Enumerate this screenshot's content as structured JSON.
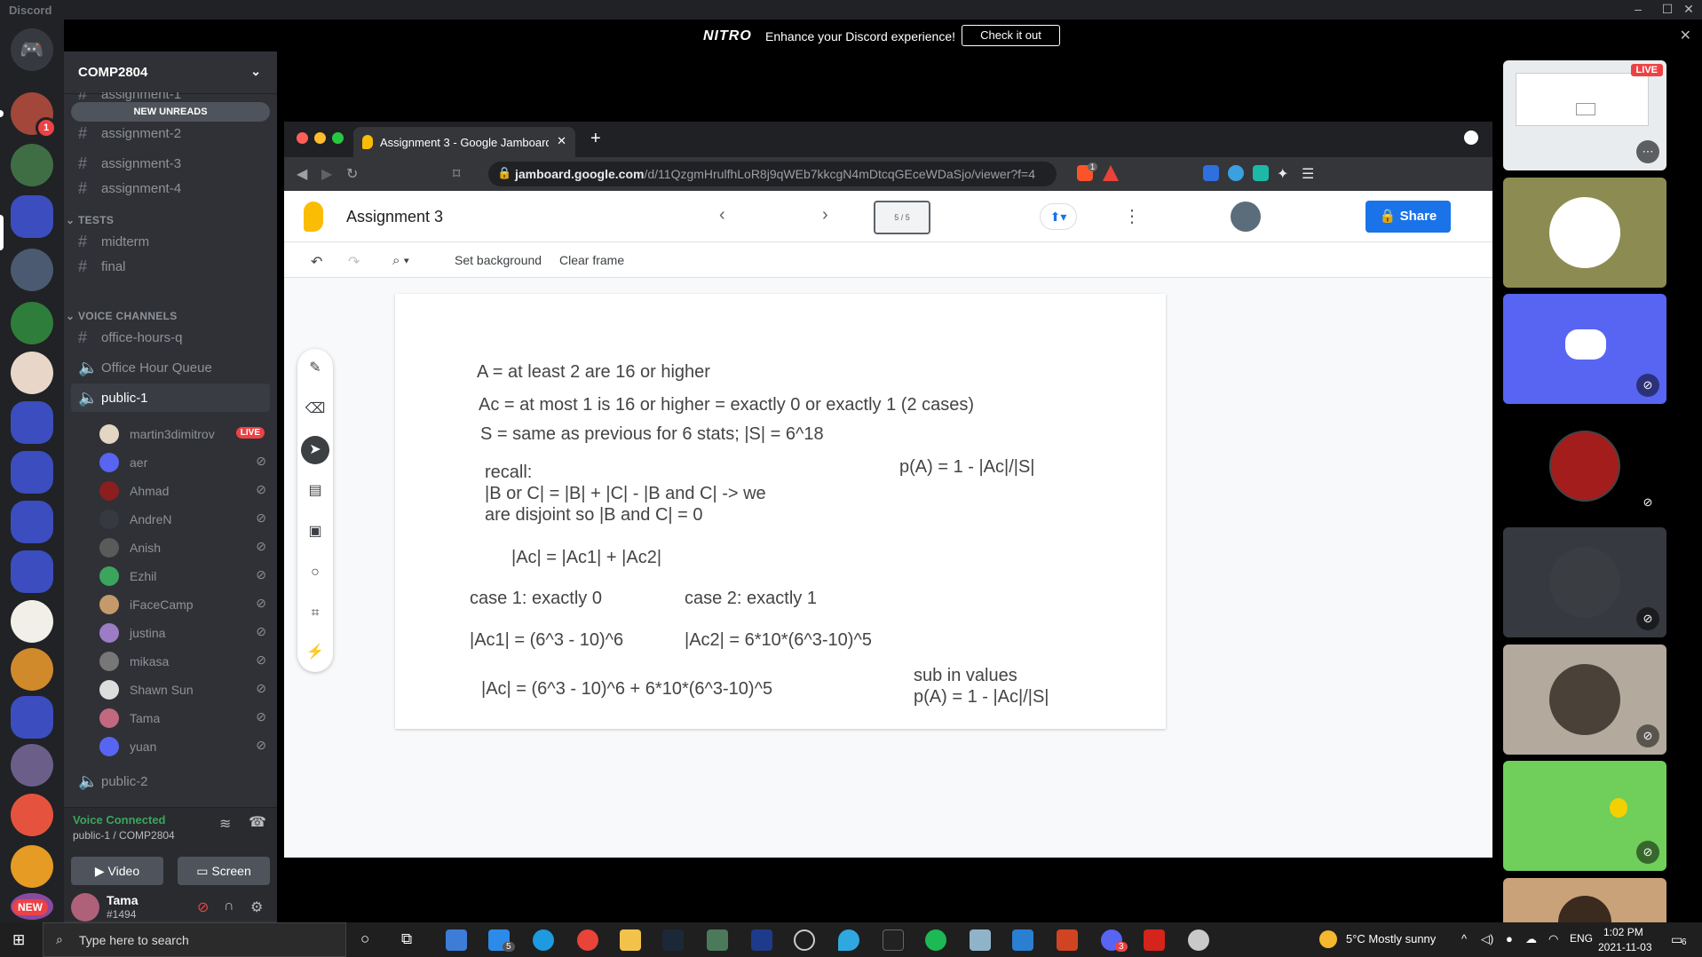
{
  "window": {
    "app_name": "Discord"
  },
  "nitro": {
    "logo": "NITRO",
    "message": "Enhance your Discord experience!",
    "cta": "Check it out"
  },
  "server": {
    "name": "COMP2804",
    "new_unreads": "NEW UNREADS"
  },
  "server_badges": {
    "notification_count": "1",
    "new_label": "NEW"
  },
  "channels": {
    "partial_top": "assignment-1",
    "text_top": [
      "assignment-2",
      "assignment-3",
      "assignment-4"
    ],
    "tests_category": "TESTS",
    "tests": [
      "midterm",
      "final"
    ],
    "voice_category": "VOICE CHANNELS",
    "voice_text": "office-hours-q",
    "voice": [
      "Office Hour Queue",
      "public-1"
    ],
    "voice_bottom": "public-2"
  },
  "voice_users": [
    {
      "name": "martin3dimitrov",
      "live": "LIVE",
      "color": "#e3d6c2"
    },
    {
      "name": "aer",
      "color": "#5865f2"
    },
    {
      "name": "Ahmad",
      "color": "#8b1e1e"
    },
    {
      "name": "AndreN",
      "color": "#36393f"
    },
    {
      "name": "Anish",
      "color": "#5a5a5a"
    },
    {
      "name": "Ezhil",
      "color": "#3ba55d"
    },
    {
      "name": "iFaceCamp",
      "color": "#c49a6c"
    },
    {
      "name": "justina",
      "color": "#9c7cc4"
    },
    {
      "name": "mikasa",
      "color": "#777"
    },
    {
      "name": "Shawn Sun",
      "color": "#ddd"
    },
    {
      "name": "Tama",
      "color": "#c2697f"
    },
    {
      "name": "yuan",
      "color": "#5865f2"
    }
  ],
  "voice_panel": {
    "status": "Voice Connected",
    "location": "public-1 / COMP2804",
    "video": "Video",
    "screen": "Screen"
  },
  "user": {
    "name": "Tama",
    "tag": "#1494"
  },
  "browser": {
    "tab_title": "Assignment 3 - Google Jamboard",
    "url_host": "jamboard.google.com",
    "url_path": "/d/11QzgmHrulfhLoR8j9qWEb7kkcgN4mDtcqGEceWDaSjo/viewer?f=4",
    "brave_count": "1"
  },
  "jamboard": {
    "title": "Assignment 3",
    "frame_counter": "5 / 5",
    "share": "Share",
    "set_background": "Set background",
    "clear_frame": "Clear frame",
    "lines": [
      "A = at least 2 are 16 or higher",
      "Ac = at most 1 is 16 or higher = exactly 0 or exactly 1 (2 cases)",
      "S = same as previous for 6 stats; |S| = 6^18",
      "p(A) = 1 - |Ac|/|S|",
      "recall:",
      "|B or C| = |B| + |C| - |B and C| -> we",
      "are disjoint so |B and C| = 0",
      "|Ac| = |Ac1| + |Ac2|",
      "case 1: exactly 0",
      "case 2: exactly 1",
      "|Ac1| = (6^3 - 10)^6",
      "|Ac2| = 6*10*(6^3-10)^5",
      "sub in values",
      "|Ac| = (6^3 - 10)^6 + 6*10*(6^3-10)^5",
      "p(A) = 1 - |Ac|/|S|"
    ]
  },
  "stream_live": "LIVE",
  "taskbar": {
    "search_placeholder": "Type here to search",
    "mail_badge": "5",
    "discord_badge": "3",
    "weather": "5°C  Mostly sunny",
    "lang": "ENG",
    "time": "1:02 PM",
    "date": "2021-11-03",
    "notif_count": "6"
  },
  "colors": {
    "rail": "#202225",
    "sidebar": "#2f3136",
    "blurple": "#5865f2",
    "green": "#3ba55d",
    "red": "#ed4245",
    "jam_blue": "#1a73e8"
  }
}
